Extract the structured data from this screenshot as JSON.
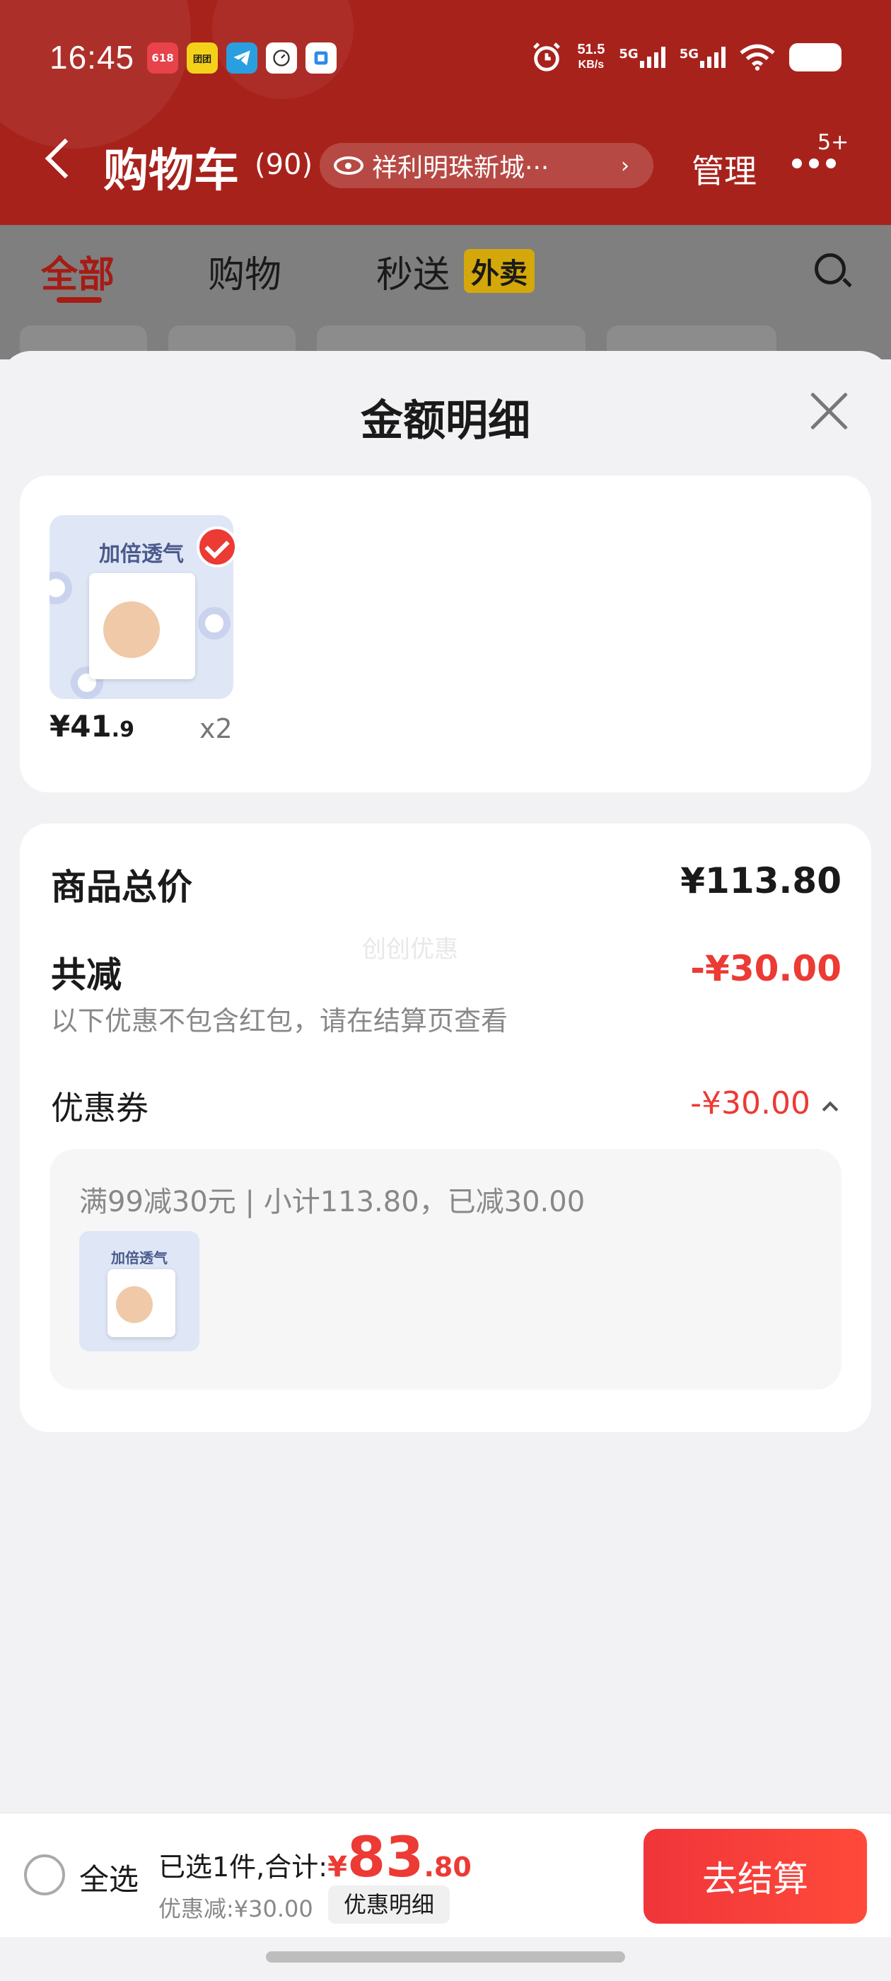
{
  "status_bar": {
    "time": "16:45",
    "app_icons": [
      "618",
      "团团",
      "telegram-icon",
      "clock-icon",
      "app-icon"
    ],
    "network_speed": "51.5",
    "network_unit": "KB/s",
    "signal1": "5G",
    "signal2": "5G"
  },
  "header": {
    "title": "购物车",
    "count": "(90)",
    "address": "祥利明珠新城···",
    "manage": "管理",
    "more_badge": "5+"
  },
  "tabs": [
    {
      "label": "全部",
      "active": true
    },
    {
      "label": "购物",
      "active": false
    },
    {
      "label": "秒送",
      "active": false
    }
  ],
  "takeout_badge": "外卖",
  "sheet": {
    "title": "金额明细",
    "product": {
      "thumb_caption": "加倍透气",
      "price_int": "¥41",
      "price_dec": ".9",
      "qty": "x2",
      "selected": true
    },
    "summary": {
      "total_label": "商品总价",
      "total_value": "¥113.80",
      "reduce_label": "共减",
      "reduce_value": "-¥30.00",
      "watermark": "创创优惠",
      "note": "以下优惠不包含红包，请在结算页查看",
      "coupon_label": "优惠券",
      "coupon_value": "-¥30.00",
      "coupon_desc": "满99减30元 | 小计113.80，已减30.00",
      "coupon_thumb_caption": "加倍透气"
    }
  },
  "bottom_bar": {
    "select_all": "全选",
    "selected_text": "已选1件,合计:",
    "total_yen": "¥",
    "total_int": "83",
    "total_dec": ".80",
    "discount": "优惠减:¥30.00",
    "detail_button": "优惠明细",
    "checkout_button": "去结算"
  },
  "colors": {
    "brand_red": "#ec3a34",
    "header_bg": "#a8221c"
  }
}
